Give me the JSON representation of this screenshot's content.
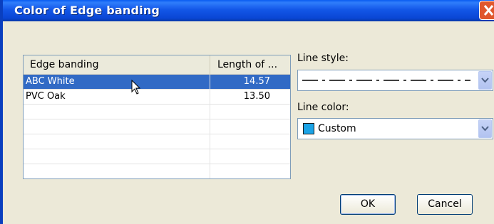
{
  "window": {
    "title": "Color of Edge banding",
    "title_color": "#0a46d4"
  },
  "table": {
    "columns": [
      "Edge banding",
      "Length of ..."
    ],
    "rows": [
      {
        "name": "ABC White",
        "length": "14.57",
        "selected": true
      },
      {
        "name": "PVC Oak",
        "length": "13.50",
        "selected": false
      }
    ],
    "empty_rows": 5,
    "selection_color": "#316ac5"
  },
  "line_style": {
    "label": "Line style:",
    "value": "dash-dot line"
  },
  "line_color": {
    "label": "Line color:",
    "value": "Custom",
    "swatch_color": "#1aa3e6"
  },
  "buttons": {
    "ok": "OK",
    "cancel": "Cancel"
  },
  "icons": {
    "close": "close-icon",
    "dropdown": "chevron-down-icon",
    "cursor": "mouse-pointer-icon"
  }
}
